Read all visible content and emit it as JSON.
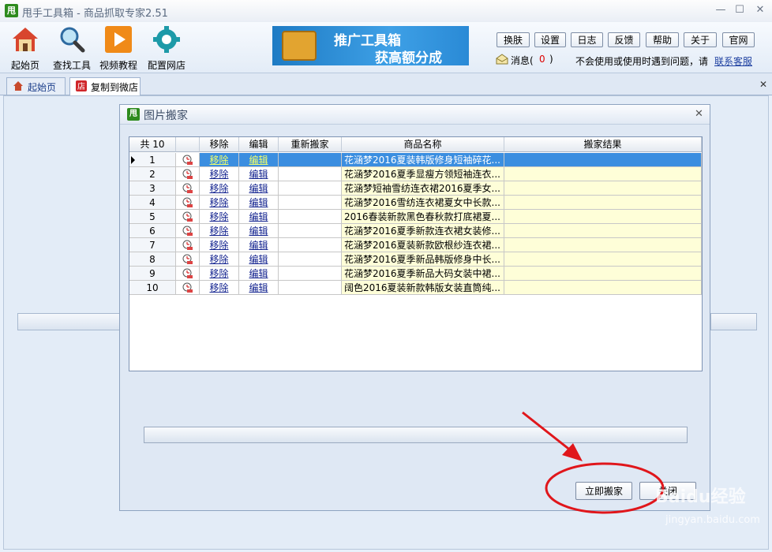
{
  "window": {
    "logo_char": "甩",
    "title": "甩手工具箱 - 商品抓取专家2.51",
    "controls": [
      "minimize",
      "maximize",
      "close"
    ]
  },
  "toolbar": {
    "items": [
      {
        "label": "起始页",
        "icon": "home-icon"
      },
      {
        "label": "查找工具",
        "icon": "search-icon"
      },
      {
        "label": "视频教程",
        "icon": "play-icon"
      },
      {
        "label": "配置网店",
        "icon": "gear-icon"
      }
    ],
    "banner": {
      "line1": "推广工具箱",
      "line2": "获高额分成"
    },
    "buttons": [
      "换肤",
      "设置",
      "日志",
      "反馈",
      "帮助",
      "关于",
      "官网"
    ],
    "message_label": "消息(",
    "message_count": "0",
    "message_close": ")",
    "help_text": "不会使用或使用时遇到问题，请",
    "contact_link": "联系客服"
  },
  "tabs": [
    {
      "label": "起始页",
      "icon": "home-icon",
      "active": false
    },
    {
      "label": "复制到微店",
      "icon": "shop-icon",
      "active": true
    }
  ],
  "dialog": {
    "logo_char": "甩",
    "title": "图片搬家",
    "columns": [
      "共 10",
      "",
      "移除",
      "编辑",
      "重新搬家",
      "商品名称",
      "搬家结果"
    ],
    "rows": [
      {
        "n": "1",
        "remove": "移除",
        "edit": "编辑",
        "redo": "",
        "name": "花涵梦2016夏装韩版修身短袖碎花...",
        "result": "",
        "selected": true
      },
      {
        "n": "2",
        "remove": "移除",
        "edit": "编辑",
        "redo": "",
        "name": "花涵梦2016夏季显瘦方领短袖连衣...",
        "result": ""
      },
      {
        "n": "3",
        "remove": "移除",
        "edit": "编辑",
        "redo": "",
        "name": "花涵梦短袖雪纺连衣裙2016夏季女...",
        "result": ""
      },
      {
        "n": "4",
        "remove": "移除",
        "edit": "编辑",
        "redo": "",
        "name": "花涵梦2016雪纺连衣裙夏女中长款...",
        "result": ""
      },
      {
        "n": "5",
        "remove": "移除",
        "edit": "编辑",
        "redo": "",
        "name": "2016春装新款黑色春秋款打底裙夏...",
        "result": ""
      },
      {
        "n": "6",
        "remove": "移除",
        "edit": "编辑",
        "redo": "",
        "name": "花涵梦2016夏季新款连衣裙女装修...",
        "result": ""
      },
      {
        "n": "7",
        "remove": "移除",
        "edit": "编辑",
        "redo": "",
        "name": "花涵梦2016夏装新款欧根纱连衣裙...",
        "result": ""
      },
      {
        "n": "8",
        "remove": "移除",
        "edit": "编辑",
        "redo": "",
        "name": "花涵梦2016夏季新品韩版修身中长...",
        "result": ""
      },
      {
        "n": "9",
        "remove": "移除",
        "edit": "编辑",
        "redo": "",
        "name": "花涵梦2016夏季新品大码女装中裙...",
        "result": ""
      },
      {
        "n": "10",
        "remove": "移除",
        "edit": "编辑",
        "redo": "",
        "name": "阔色2016夏装新款韩版女装直筒纯...",
        "result": ""
      }
    ],
    "start_button": "立即搬家",
    "close_button": "关闭"
  },
  "annotations": {
    "watermark": "Baidu经验",
    "watermark_url": "jingyan.baidu.com",
    "highlight_color": "#e0161b"
  },
  "colors": {
    "selection": "#3b8ee0",
    "row_yellow": "#fefed8",
    "link": "#13238f",
    "msg_count": "#dd0000"
  }
}
